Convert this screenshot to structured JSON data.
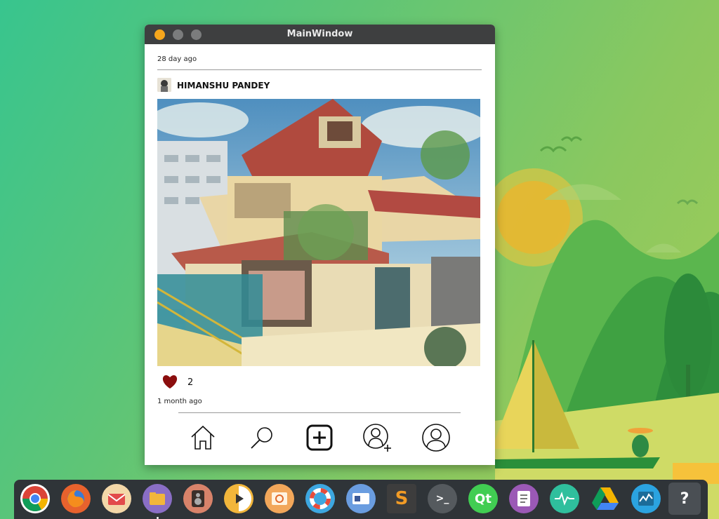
{
  "window": {
    "title": "MainWindow"
  },
  "post": {
    "top_timestamp": "28 day ago",
    "username": "HIMANSHU PANDEY",
    "likes": "2",
    "bottom_timestamp": "1 month ago"
  },
  "bottom_nav": [
    "home-icon",
    "search-icon",
    "add-post-icon",
    "add-user-icon",
    "profile-icon"
  ],
  "dock": {
    "apps": [
      {
        "name": "chrome-icon",
        "color": "#ffffff"
      },
      {
        "name": "firefox-icon",
        "color": "#e8622d"
      },
      {
        "name": "mail-icon",
        "color": "#f3d7a8"
      },
      {
        "name": "files-icon",
        "color": "#8a6ec6"
      },
      {
        "name": "speaker-icon",
        "color": "#d9836a"
      },
      {
        "name": "player-icon",
        "color": "#f2b63b"
      },
      {
        "name": "image-editor-icon",
        "color": "#f2a75a"
      },
      {
        "name": "help-ring-icon",
        "color": "#3da7e0"
      },
      {
        "name": "panel-icon",
        "color": "#6a9de0"
      },
      {
        "name": "sublime-text-icon",
        "color": "#3d3d3d"
      },
      {
        "name": "terminal-icon",
        "color": "#555a5e"
      },
      {
        "name": "qt-icon",
        "color": "#41cd52"
      },
      {
        "name": "text-editor-icon",
        "color": "#9b59b6"
      },
      {
        "name": "system-monitor-icon",
        "color": "#2fbf9d"
      },
      {
        "name": "google-drive-icon",
        "color": "#ffffff"
      },
      {
        "name": "activity-icon",
        "color": "#2ba3e0"
      },
      {
        "name": "unknown-app-icon",
        "color": "#4a4f54"
      }
    ],
    "labels": {
      "qt": "Qt",
      "sublime": "S",
      "terminal": ">_",
      "unknown": "?"
    }
  },
  "colors": {
    "accent": "#f6a61c",
    "heart": "#8b0e0e",
    "titlebar": "#3e3f40"
  }
}
